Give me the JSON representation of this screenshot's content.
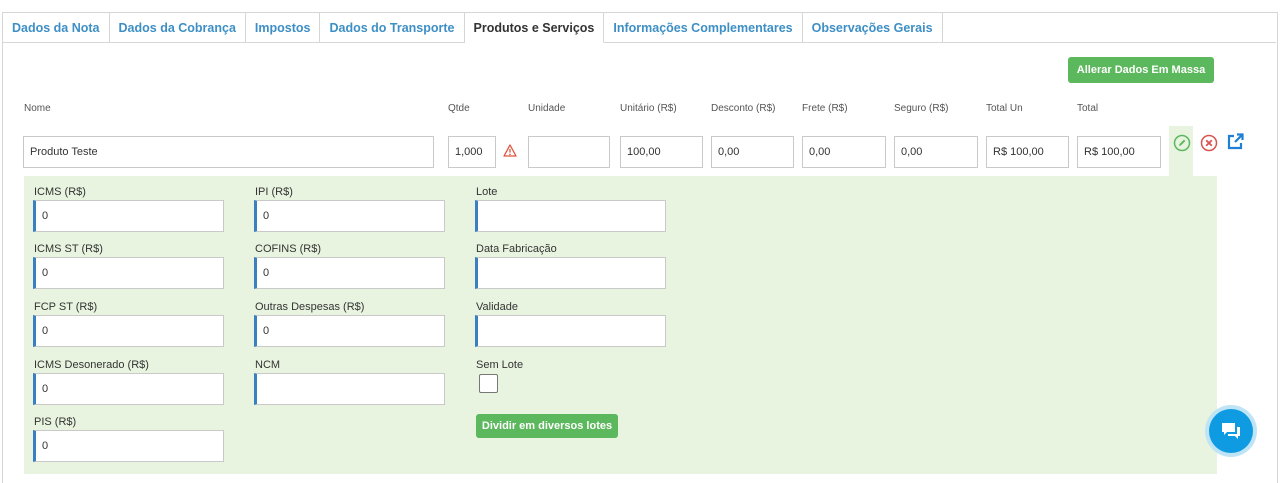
{
  "tabs": [
    {
      "label": "Dados da Nota"
    },
    {
      "label": "Dados da Cobrança"
    },
    {
      "label": "Impostos"
    },
    {
      "label": "Dados do Transporte"
    },
    {
      "label": "Produtos e Serviços"
    },
    {
      "label": "Informações Complementares"
    },
    {
      "label": "Observações Gerais"
    }
  ],
  "active_tab": "Produtos e Serviços",
  "mass_edit_button": "Allerar Dados Em Massa",
  "columns": {
    "nome": "Nome",
    "qtde": "Qtde",
    "unidade": "Unidade",
    "unitario": "Unitário (R$)",
    "desconto": "Desconto (R$)",
    "frete": "Frete (R$)",
    "seguro": "Seguro (R$)",
    "total_un": "Total Un",
    "total": "Total"
  },
  "item": {
    "nome": "Produto Teste",
    "qtde": "1,000",
    "unidade": "",
    "unitario": "100,00",
    "desconto": "0,00",
    "frete": "0,00",
    "seguro": "0,00",
    "total_un": "R$ 100,00",
    "total": "R$ 100,00"
  },
  "details": {
    "icms": {
      "label": "ICMS (R$)",
      "value": "0"
    },
    "icms_st": {
      "label": "ICMS ST (R$)",
      "value": "0"
    },
    "fcp_st": {
      "label": "FCP ST (R$)",
      "value": "0"
    },
    "icms_desonerado": {
      "label": "ICMS Desonerado (R$)",
      "value": "0"
    },
    "pis": {
      "label": "PIS (R$)",
      "value": "0"
    },
    "ipi": {
      "label": "IPI (R$)",
      "value": "0"
    },
    "cofins": {
      "label": "COFINS (R$)",
      "value": "0"
    },
    "outras_despesas": {
      "label": "Outras Despesas (R$)",
      "value": "0"
    },
    "ncm": {
      "label": "NCM",
      "value": ""
    },
    "lote": {
      "label": "Lote",
      "value": ""
    },
    "data_fabricacao": {
      "label": "Data Fabricação",
      "value": ""
    },
    "validade": {
      "label": "Validade",
      "value": ""
    },
    "sem_lote": {
      "label": "Sem Lote"
    },
    "split_button": "Dividir em diversos lotes"
  },
  "icons": {
    "warning": "warning-triangle-icon",
    "edit": "pencil-circle-icon",
    "remove": "close-circle-icon",
    "open": "external-link-icon",
    "chat": "chat-bubble-icon"
  },
  "colors": {
    "tab_text": "#3d8fc6",
    "green_button": "#5cb85c",
    "panel_bg": "#e8f4e0",
    "input_accent": "#3a7fc0",
    "chat": "#0f9be2"
  }
}
